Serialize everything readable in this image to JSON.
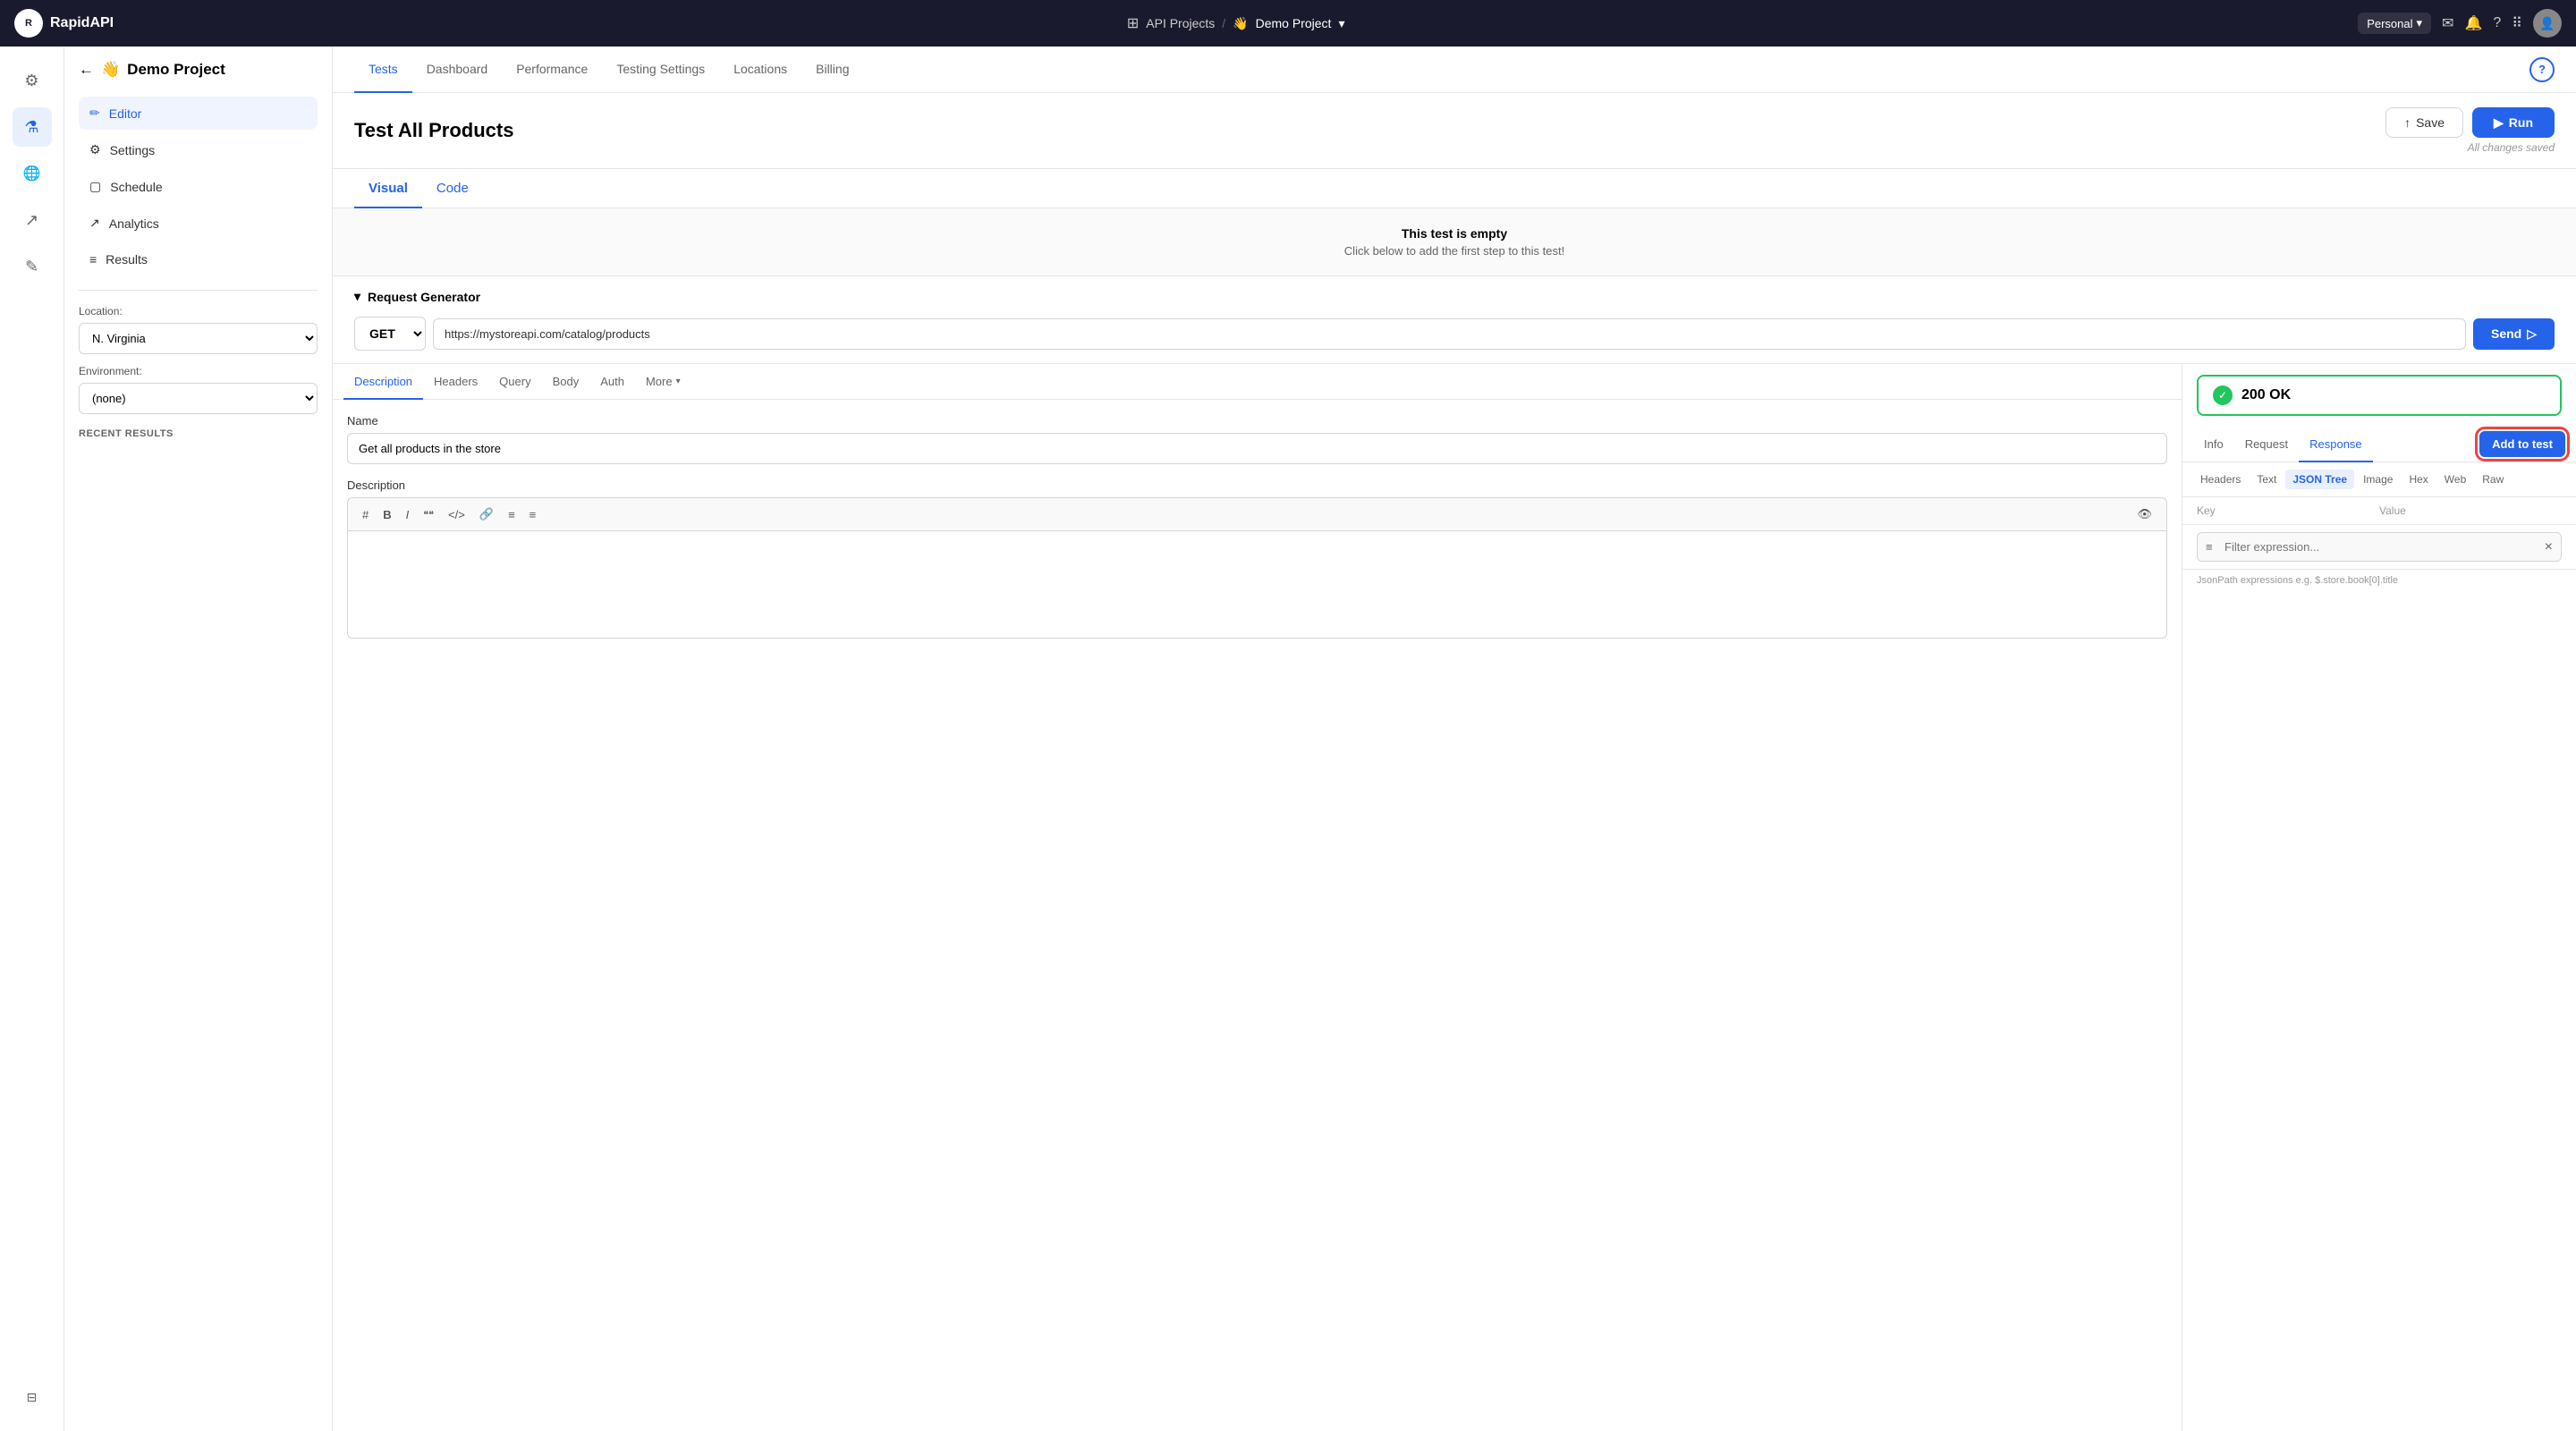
{
  "app": {
    "name": "RapidAPI"
  },
  "topnav": {
    "api_projects": "API Projects",
    "separator": "/",
    "demo_project": "Demo Project",
    "workspace": "Personal",
    "grid_icon": "⠿"
  },
  "sidebar_icons": [
    {
      "name": "settings-icon",
      "icon": "⚙",
      "active": false
    },
    {
      "name": "flask-icon",
      "icon": "⚗",
      "active": true
    },
    {
      "name": "globe-icon",
      "icon": "🌐",
      "active": false
    },
    {
      "name": "chart-icon",
      "icon": "↗",
      "active": false
    },
    {
      "name": "pen-icon",
      "icon": "✎",
      "active": false
    }
  ],
  "top_tabs": {
    "tabs": [
      {
        "label": "Tests",
        "active": true
      },
      {
        "label": "Dashboard",
        "active": false
      },
      {
        "label": "Performance",
        "active": false
      },
      {
        "label": "Testing Settings",
        "active": false
      },
      {
        "label": "Locations",
        "active": false
      },
      {
        "label": "Billing",
        "active": false
      }
    ]
  },
  "left_panel": {
    "back_arrow": "←",
    "project_emoji": "👋",
    "project_name": "Demo Project",
    "menu_items": [
      {
        "label": "Editor",
        "icon": "✏",
        "active": true
      },
      {
        "label": "Settings",
        "icon": "⚙",
        "active": false
      },
      {
        "label": "Schedule",
        "icon": "▢",
        "active": false
      },
      {
        "label": "Analytics",
        "icon": "↗",
        "active": false
      },
      {
        "label": "Results",
        "icon": "≡",
        "active": false
      }
    ],
    "location_label": "Location:",
    "location_value": "N. Virginia",
    "environment_label": "Environment:",
    "environment_value": "(none)",
    "recent_results_label": "RECENT RESULTS"
  },
  "test_header": {
    "title": "Test All Products",
    "save_label": "Save",
    "run_label": "Run",
    "saved_text": "All changes saved"
  },
  "view_tabs": {
    "visual": "Visual",
    "code": "Code"
  },
  "empty_test": {
    "title": "This test is empty",
    "subtitle": "Click below to add the first step to this test!"
  },
  "request_generator": {
    "header": "Request Generator",
    "method": "GET",
    "url": "https://mystoreapi.com/catalog/products",
    "send_label": "Send"
  },
  "desc_tabs": {
    "tabs": [
      {
        "label": "Description",
        "active": true
      },
      {
        "label": "Headers",
        "active": false
      },
      {
        "label": "Query",
        "active": false
      },
      {
        "label": "Body",
        "active": false
      },
      {
        "label": "Auth",
        "active": false
      },
      {
        "label": "More",
        "active": false
      }
    ]
  },
  "desc_fields": {
    "name_label": "Name",
    "name_value": "Get all products in the store",
    "description_label": "Description",
    "toolbar_icons": [
      "#",
      "B",
      "I",
      "❝❝",
      "</>",
      "🔗",
      "≡",
      "≡",
      "👁"
    ]
  },
  "response_section": {
    "status": "200 OK",
    "tabs": [
      {
        "label": "Info",
        "active": false
      },
      {
        "label": "Request",
        "active": false
      },
      {
        "label": "Response",
        "active": true
      }
    ],
    "add_to_test": "Add to test",
    "view_tabs": [
      {
        "label": "Headers",
        "active": false
      },
      {
        "label": "Text",
        "active": false
      },
      {
        "label": "JSON Tree",
        "active": true
      },
      {
        "label": "Image",
        "active": false
      },
      {
        "label": "Hex",
        "active": false
      },
      {
        "label": "Web",
        "active": false
      },
      {
        "label": "Raw",
        "active": false
      }
    ],
    "key_label": "Key",
    "value_label": "Value",
    "filter_placeholder": "Filter expression...",
    "filter_icon": "≡",
    "close_icon": "×",
    "json_path_hint": "JsonPath expressions e.g. $.store.book[0].title"
  }
}
